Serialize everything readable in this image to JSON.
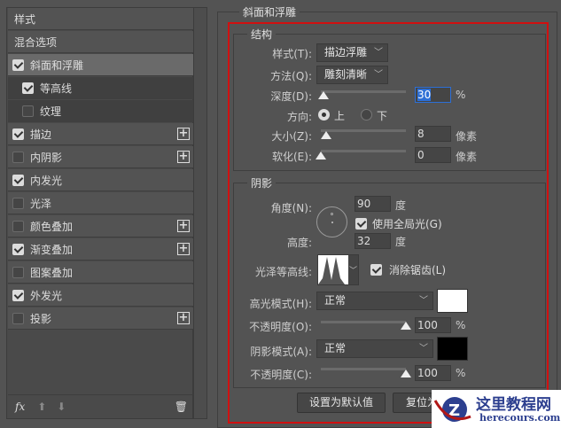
{
  "sidebar": {
    "header": "样式",
    "blend": "混合选项",
    "items": [
      {
        "label": "斜面和浮雕",
        "checked": true,
        "plus": false
      },
      {
        "label": "等高线",
        "checked": true,
        "plus": false
      },
      {
        "label": "纹理",
        "checked": false,
        "plus": false
      },
      {
        "label": "描边",
        "checked": true,
        "plus": true
      },
      {
        "label": "内阴影",
        "checked": false,
        "plus": true
      },
      {
        "label": "内发光",
        "checked": true,
        "plus": false
      },
      {
        "label": "光泽",
        "checked": false,
        "plus": false
      },
      {
        "label": "颜色叠加",
        "checked": false,
        "plus": true
      },
      {
        "label": "渐变叠加",
        "checked": true,
        "plus": true
      },
      {
        "label": "图案叠加",
        "checked": false,
        "plus": false
      },
      {
        "label": "外发光",
        "checked": true,
        "plus": false
      },
      {
        "label": "投影",
        "checked": false,
        "plus": true
      }
    ],
    "fx": "fx"
  },
  "panel": {
    "title": "斜面和浮雕",
    "structure": {
      "title": "结构",
      "style_label": "样式(T):",
      "style_value": "描边浮雕",
      "technique_label": "方法(Q):",
      "technique_value": "雕刻清晰",
      "depth_label": "深度(D):",
      "depth_value": "30",
      "depth_unit": "%",
      "depth_slider": 0.03,
      "direction_label": "方向:",
      "dir_up": "上",
      "dir_down": "下",
      "direction_selected": "上",
      "size_label": "大小(Z):",
      "size_value": "8",
      "size_unit": "像素",
      "size_slider": 0.06,
      "soften_label": "软化(E):",
      "soften_value": "0",
      "soften_unit": "像素",
      "soften_slider": 0
    },
    "shading": {
      "title": "阴影",
      "angle_label": "角度(N):",
      "angle_value": "90",
      "angle_unit": "度",
      "global_light": "使用全局光(G)",
      "global_light_checked": true,
      "altitude_label": "高度:",
      "altitude_value": "32",
      "altitude_unit": "度",
      "gloss_label": "光泽等高线:",
      "antialias": "消除锯齿(L)",
      "antialias_checked": true,
      "highlight_label": "高光模式(H):",
      "highlight_mode": "正常",
      "highlight_color": "#ffffff",
      "hl_opacity_label": "不透明度(O):",
      "hl_opacity": "100",
      "hl_opacity_unit": "%",
      "shadow_label": "阴影模式(A):",
      "shadow_mode": "正常",
      "shadow_color": "#000000",
      "sh_opacity_label": "不透明度(C):",
      "sh_opacity": "100",
      "sh_opacity_unit": "%"
    },
    "make_default": "设置为默认值",
    "reset_default": "复位为默认值"
  },
  "watermark": {
    "name": "这里教程网",
    "url": "herecours.com"
  },
  "colors": {
    "highlight_box": "#d01010"
  }
}
